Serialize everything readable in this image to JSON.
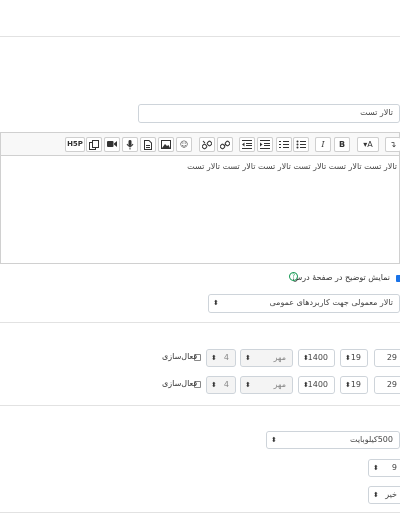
{
  "name_field": {
    "value": "تالار تست"
  },
  "toolbar": {
    "buttons": [
      {
        "name": "h5p-button",
        "label": "H5P"
      },
      {
        "name": "copy-button",
        "label": ""
      },
      {
        "name": "video-button",
        "label": ""
      },
      {
        "name": "audio-button",
        "label": ""
      },
      {
        "name": "file-button",
        "label": ""
      },
      {
        "name": "image-button",
        "label": ""
      },
      {
        "name": "emoji-button",
        "label": "☺"
      },
      {
        "name": "unlink-button",
        "label": ""
      },
      {
        "name": "link-button",
        "label": ""
      },
      {
        "name": "outdent-button",
        "label": ""
      },
      {
        "name": "indent-button",
        "label": ""
      },
      {
        "name": "ordered-list-button",
        "label": ""
      },
      {
        "name": "bullet-list-button",
        "label": ""
      },
      {
        "name": "italic-button",
        "label": "I"
      },
      {
        "name": "bold-button",
        "label": "B"
      },
      {
        "name": "font-style-button",
        "label": "▾A"
      },
      {
        "name": "expand-toolbar-button",
        "label": "↴"
      }
    ]
  },
  "editor": {
    "text": "تالار تست تالار تست تالار تست تالار تست تالار تست تالار تست"
  },
  "show_description": {
    "label": "نمایش توضیح در صفحهٔ درس",
    "help": "?"
  },
  "forum_type": {
    "value": "تالار معمولی جهت کاربردهای عمومی"
  },
  "date_rows": [
    {
      "day": "29",
      "day2": "19",
      "month": "مهر",
      "year": "1400",
      "hour": "4",
      "enable_label": "فعال‌سازی"
    },
    {
      "day": "29",
      "day2": "19",
      "month": "مهر",
      "year": "1400",
      "hour": "4",
      "enable_label": "فعال‌سازی"
    }
  ],
  "max_size": {
    "value": "500کیلوبایت"
  },
  "max_attachments": {
    "value": "9"
  },
  "word_count": {
    "value": "خیر"
  }
}
